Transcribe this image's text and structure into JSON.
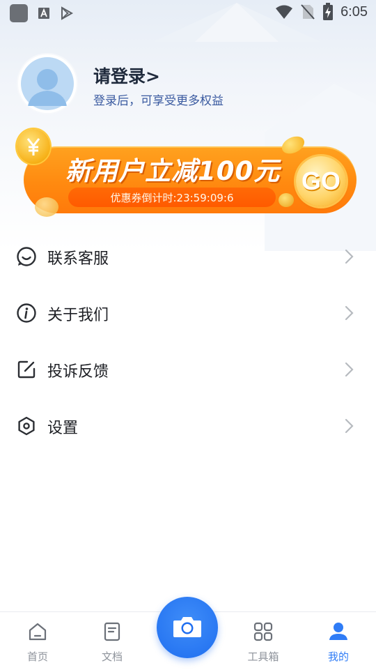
{
  "status_bar": {
    "time": "6:05",
    "icons": [
      "app-square-icon",
      "a-text-icon",
      "play-store-icon",
      "wifi-icon",
      "no-sim-icon",
      "battery-charging-icon"
    ]
  },
  "profile": {
    "title": "请登录>",
    "subtitle": "登录后，可享受更多权益"
  },
  "promo_banner": {
    "title": "新用户立减100元",
    "countdown": "优惠券倒计时:23:59:09:6",
    "button": "GO"
  },
  "menu": {
    "items": [
      {
        "label": "联系客服",
        "icon": "customer-service-icon"
      },
      {
        "label": "关于我们",
        "icon": "info-icon"
      },
      {
        "label": "投诉反馈",
        "icon": "edit-icon"
      },
      {
        "label": "设置",
        "icon": "settings-icon"
      }
    ]
  },
  "tab_bar": {
    "items": [
      {
        "label": "首页",
        "icon": "home-icon",
        "active": false
      },
      {
        "label": "文档",
        "icon": "document-icon",
        "active": false
      },
      {
        "label": "工具箱",
        "icon": "grid-icon",
        "active": false
      },
      {
        "label": "我的",
        "icon": "user-icon",
        "active": true
      }
    ],
    "center_button_icon": "camera-icon"
  },
  "colors": {
    "accent": "#2f7cf6",
    "banner_orange": "#ff8a10",
    "text_primary": "#1d1f24",
    "tab_inactive": "#8e939b"
  }
}
